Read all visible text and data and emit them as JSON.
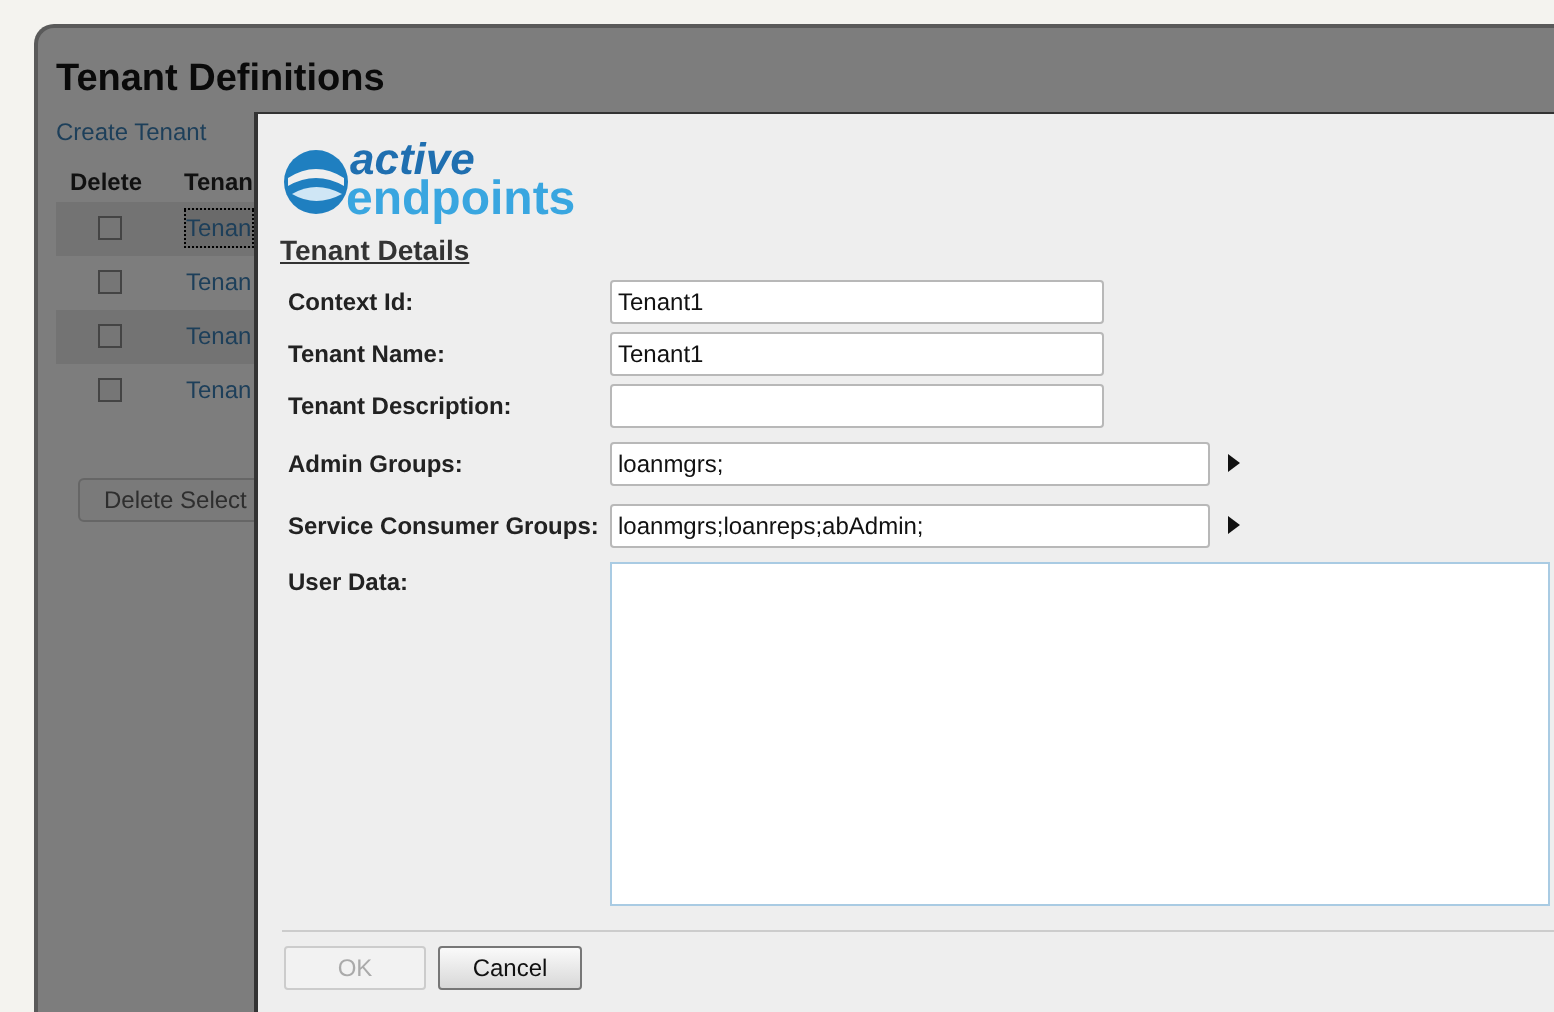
{
  "page": {
    "title": "Tenant Definitions",
    "create_link": "Create Tenant",
    "columns": [
      "Delete",
      "Tenan"
    ],
    "rows": [
      {
        "name": "Tenan",
        "checked": false,
        "focused": true
      },
      {
        "name": "Tenan",
        "checked": false,
        "focused": false
      },
      {
        "name": "Tenan",
        "checked": false,
        "focused": false
      },
      {
        "name": "Tenan",
        "checked": false,
        "focused": false
      }
    ],
    "delete_button": {
      "label": "Delete Select",
      "disabled": true
    }
  },
  "dialog": {
    "logo": {
      "line_1": "active",
      "line_2": "endpoints"
    },
    "heading": "Tenant Details",
    "fields": [
      {
        "kind": "text",
        "label": "Context Id:",
        "value": "Tenant1"
      },
      {
        "kind": "text",
        "label": "Tenant Name:",
        "value": "Tenant1"
      },
      {
        "kind": "text",
        "label": "Tenant Description:"
      },
      {
        "kind": "picker",
        "label": "Admin Groups:",
        "value": "loanmgrs;"
      },
      {
        "kind": "picker",
        "label": "Service Consumer Groups:",
        "value": "loanmgrs;loanreps;abAdmin;"
      },
      {
        "kind": "area",
        "label": "User Data:"
      }
    ],
    "buttons": [
      {
        "label": "OK",
        "disabled": true
      },
      {
        "label": "Cancel",
        "disabled": false
      }
    ]
  }
}
